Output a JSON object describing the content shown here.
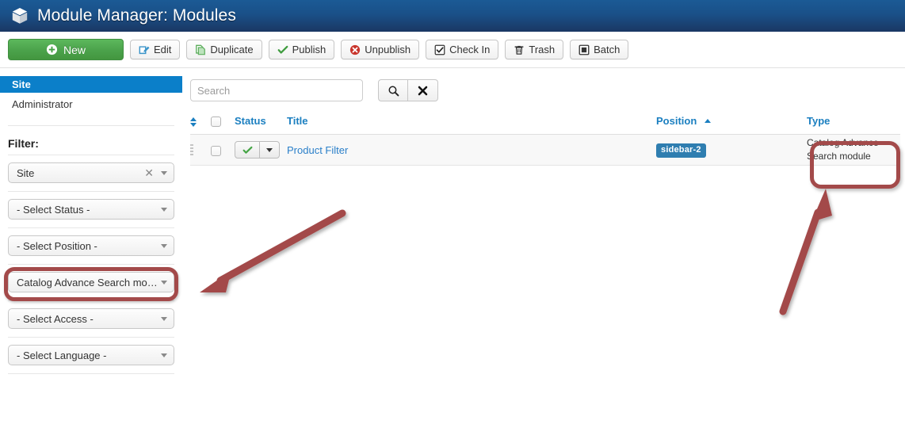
{
  "header": {
    "title": "Module Manager: Modules",
    "icon": "cube-icon"
  },
  "toolbar": {
    "buttons": [
      {
        "label": "New",
        "icon": "plus-circle-icon"
      },
      {
        "label": "Edit",
        "icon": "pencil-square-icon"
      },
      {
        "label": "Duplicate",
        "icon": "copy-icon"
      },
      {
        "label": "Publish",
        "icon": "check-icon"
      },
      {
        "label": "Unpublish",
        "icon": "cancel-circle-icon"
      },
      {
        "label": "Check In",
        "icon": "checkbox-icon"
      },
      {
        "label": "Trash",
        "icon": "trash-icon"
      },
      {
        "label": "Batch",
        "icon": "square-icon"
      }
    ]
  },
  "sidebar": {
    "nav": [
      {
        "label": "Site",
        "active": true
      },
      {
        "label": "Administrator",
        "active": false
      }
    ],
    "filter_heading": "Filter:",
    "filters": [
      {
        "name": "site",
        "value": "Site",
        "clearable": true,
        "highlighted": false
      },
      {
        "name": "status",
        "value": "- Select Status -",
        "clearable": false,
        "highlighted": false
      },
      {
        "name": "position",
        "value": "- Select Position -",
        "clearable": false,
        "highlighted": false
      },
      {
        "name": "type",
        "value": "Catalog Advance Search mo…",
        "clearable": false,
        "highlighted": true
      },
      {
        "name": "access",
        "value": "- Select Access -",
        "clearable": false,
        "highlighted": false
      },
      {
        "name": "language",
        "value": "- Select Language -",
        "clearable": false,
        "highlighted": false
      }
    ]
  },
  "search": {
    "value": "",
    "placeholder": "Search",
    "search_icon": "magnifier-icon",
    "clear_icon": "x-icon"
  },
  "table": {
    "columns": {
      "ordering": "",
      "checkall": "",
      "status": "Status",
      "title": "Title",
      "position": "Position",
      "type": "Type"
    },
    "sorted_column": "Position",
    "sort_direction": "asc",
    "rows": [
      {
        "status_state": "published",
        "title": "Product Filter",
        "position": "sidebar-2",
        "type": "Catalog Advance Search module"
      }
    ]
  },
  "annotations": {
    "accent_color": "#a34a4a",
    "arrows": [
      {
        "name": "arrow-to-type-filter",
        "direction": "down-left"
      },
      {
        "name": "arrow-to-type-column",
        "direction": "up-right"
      }
    ],
    "highlights": [
      {
        "name": "type-filter-highlight"
      },
      {
        "name": "type-cell-highlight"
      }
    ]
  }
}
